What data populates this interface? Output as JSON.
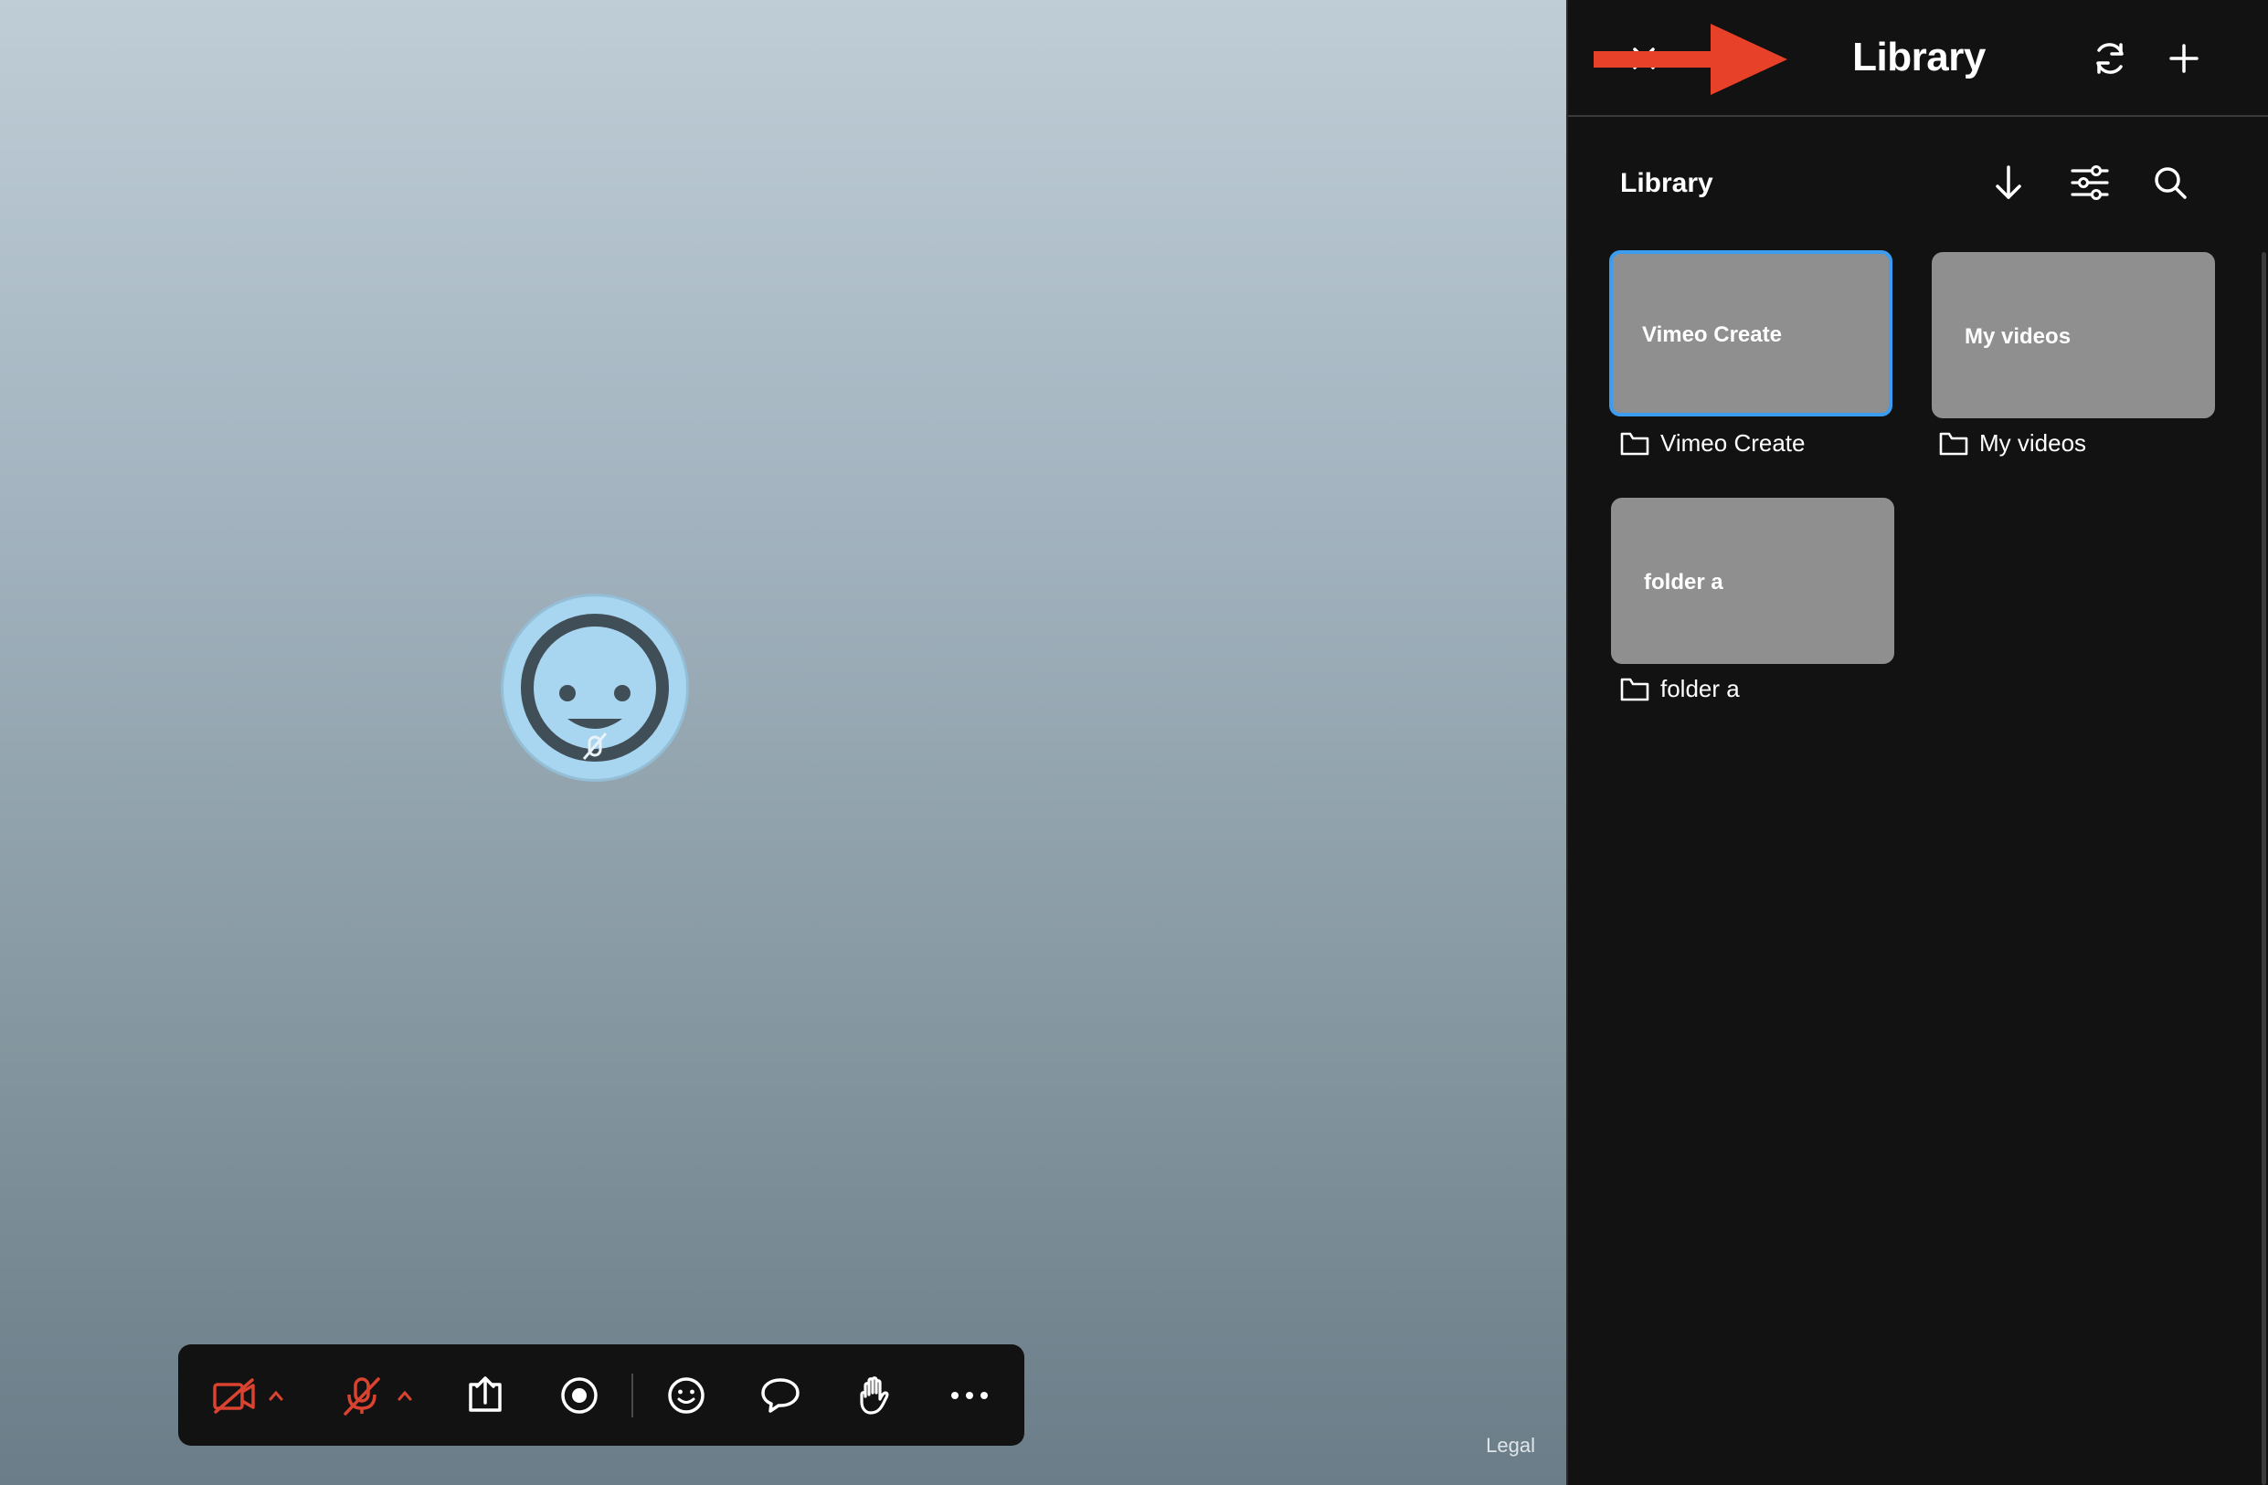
{
  "stage": {
    "legal_label": "Legal"
  },
  "toolbar": {
    "buttons": [
      {
        "name": "video-off-button",
        "icon": "video-off-icon",
        "color": "#d9432f"
      },
      {
        "name": "mic-off-button",
        "icon": "mic-off-icon",
        "color": "#d9432f"
      },
      {
        "name": "share-screen-button",
        "icon": "share-screen-icon"
      },
      {
        "name": "record-button",
        "icon": "record-icon"
      },
      {
        "name": "reactions-button",
        "icon": "smiley-icon"
      },
      {
        "name": "chat-button",
        "icon": "chat-bubble-icon"
      },
      {
        "name": "raise-hand-button",
        "icon": "raise-hand-icon"
      },
      {
        "name": "more-button",
        "icon": "more-horizontal-icon"
      }
    ]
  },
  "panel": {
    "title": "Library",
    "subtitle": "Library",
    "folders": [
      {
        "card_label": "Vimeo Create",
        "name": "Vimeo Create",
        "selected": true
      },
      {
        "card_label": "My videos",
        "name": "My videos",
        "selected": false
      },
      {
        "card_label": "folder a",
        "name": "folder a",
        "selected": false
      }
    ]
  },
  "colors": {
    "accent": "#3b9cf0",
    "danger": "#d9432f",
    "annotation": "#e8412a",
    "panel_bg": "#121212",
    "card_bg": "#8f8f8f"
  }
}
